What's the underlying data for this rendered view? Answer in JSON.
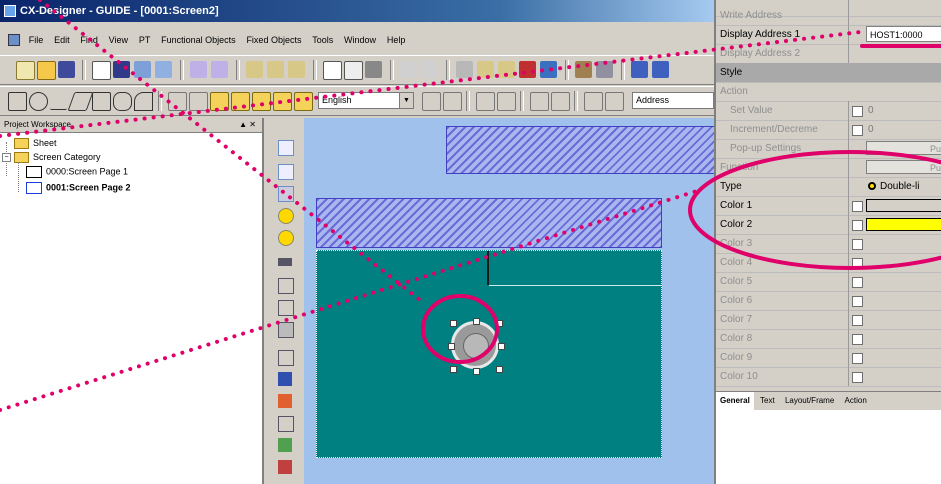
{
  "window": {
    "title": "CX-Designer - GUIDE - [0001:Screen2]"
  },
  "menubar": {
    "items": [
      "File",
      "Edit",
      "Find",
      "View",
      "PT",
      "Functional Objects",
      "Fixed Objects",
      "Tools",
      "Window",
      "Help"
    ]
  },
  "toolbar2": {
    "language_value": "English",
    "address_value": "Address"
  },
  "workspace": {
    "title": "Project Workspace",
    "controls": "▲ ✕",
    "tree": {
      "sheet": "Sheet",
      "screen_category": "Screen Category",
      "page1": "0000:Screen Page 1",
      "page2": "0001:Screen Page 2"
    }
  },
  "properties": {
    "rows_top": [
      {
        "name": "Write Address",
        "value": ""
      },
      {
        "name": "Display Address 1",
        "value": "HOST1:0000"
      },
      {
        "name": "Display Address 2",
        "value": ""
      }
    ],
    "section_style": "Style",
    "action": "Action",
    "set_value": {
      "name": "Set Value",
      "value": "0"
    },
    "increment": {
      "name": "Increment/Decreme",
      "value": "0"
    },
    "popup": {
      "name": "Pop-up Settings",
      "value": "Pu"
    },
    "function": {
      "name": "Function",
      "value": "Pu"
    },
    "type": {
      "name": "Type",
      "value": "Double-li"
    },
    "colors": [
      {
        "name": "Color 1",
        "swatch": "#d4d0c8"
      },
      {
        "name": "Color 2",
        "swatch": "#ffff00"
      },
      {
        "name": "Color 3"
      },
      {
        "name": "Color 4"
      },
      {
        "name": "Color 5"
      },
      {
        "name": "Color 6"
      },
      {
        "name": "Color 7"
      },
      {
        "name": "Color 8"
      },
      {
        "name": "Color 9"
      },
      {
        "name": "Color 10"
      }
    ],
    "tabs": [
      "General",
      "Text",
      "Layout/Frame",
      "Action"
    ]
  },
  "colors": {
    "annotation": "#e0006a",
    "canvas_bg": "#9fc1eb",
    "screen_bg": "#008080"
  }
}
